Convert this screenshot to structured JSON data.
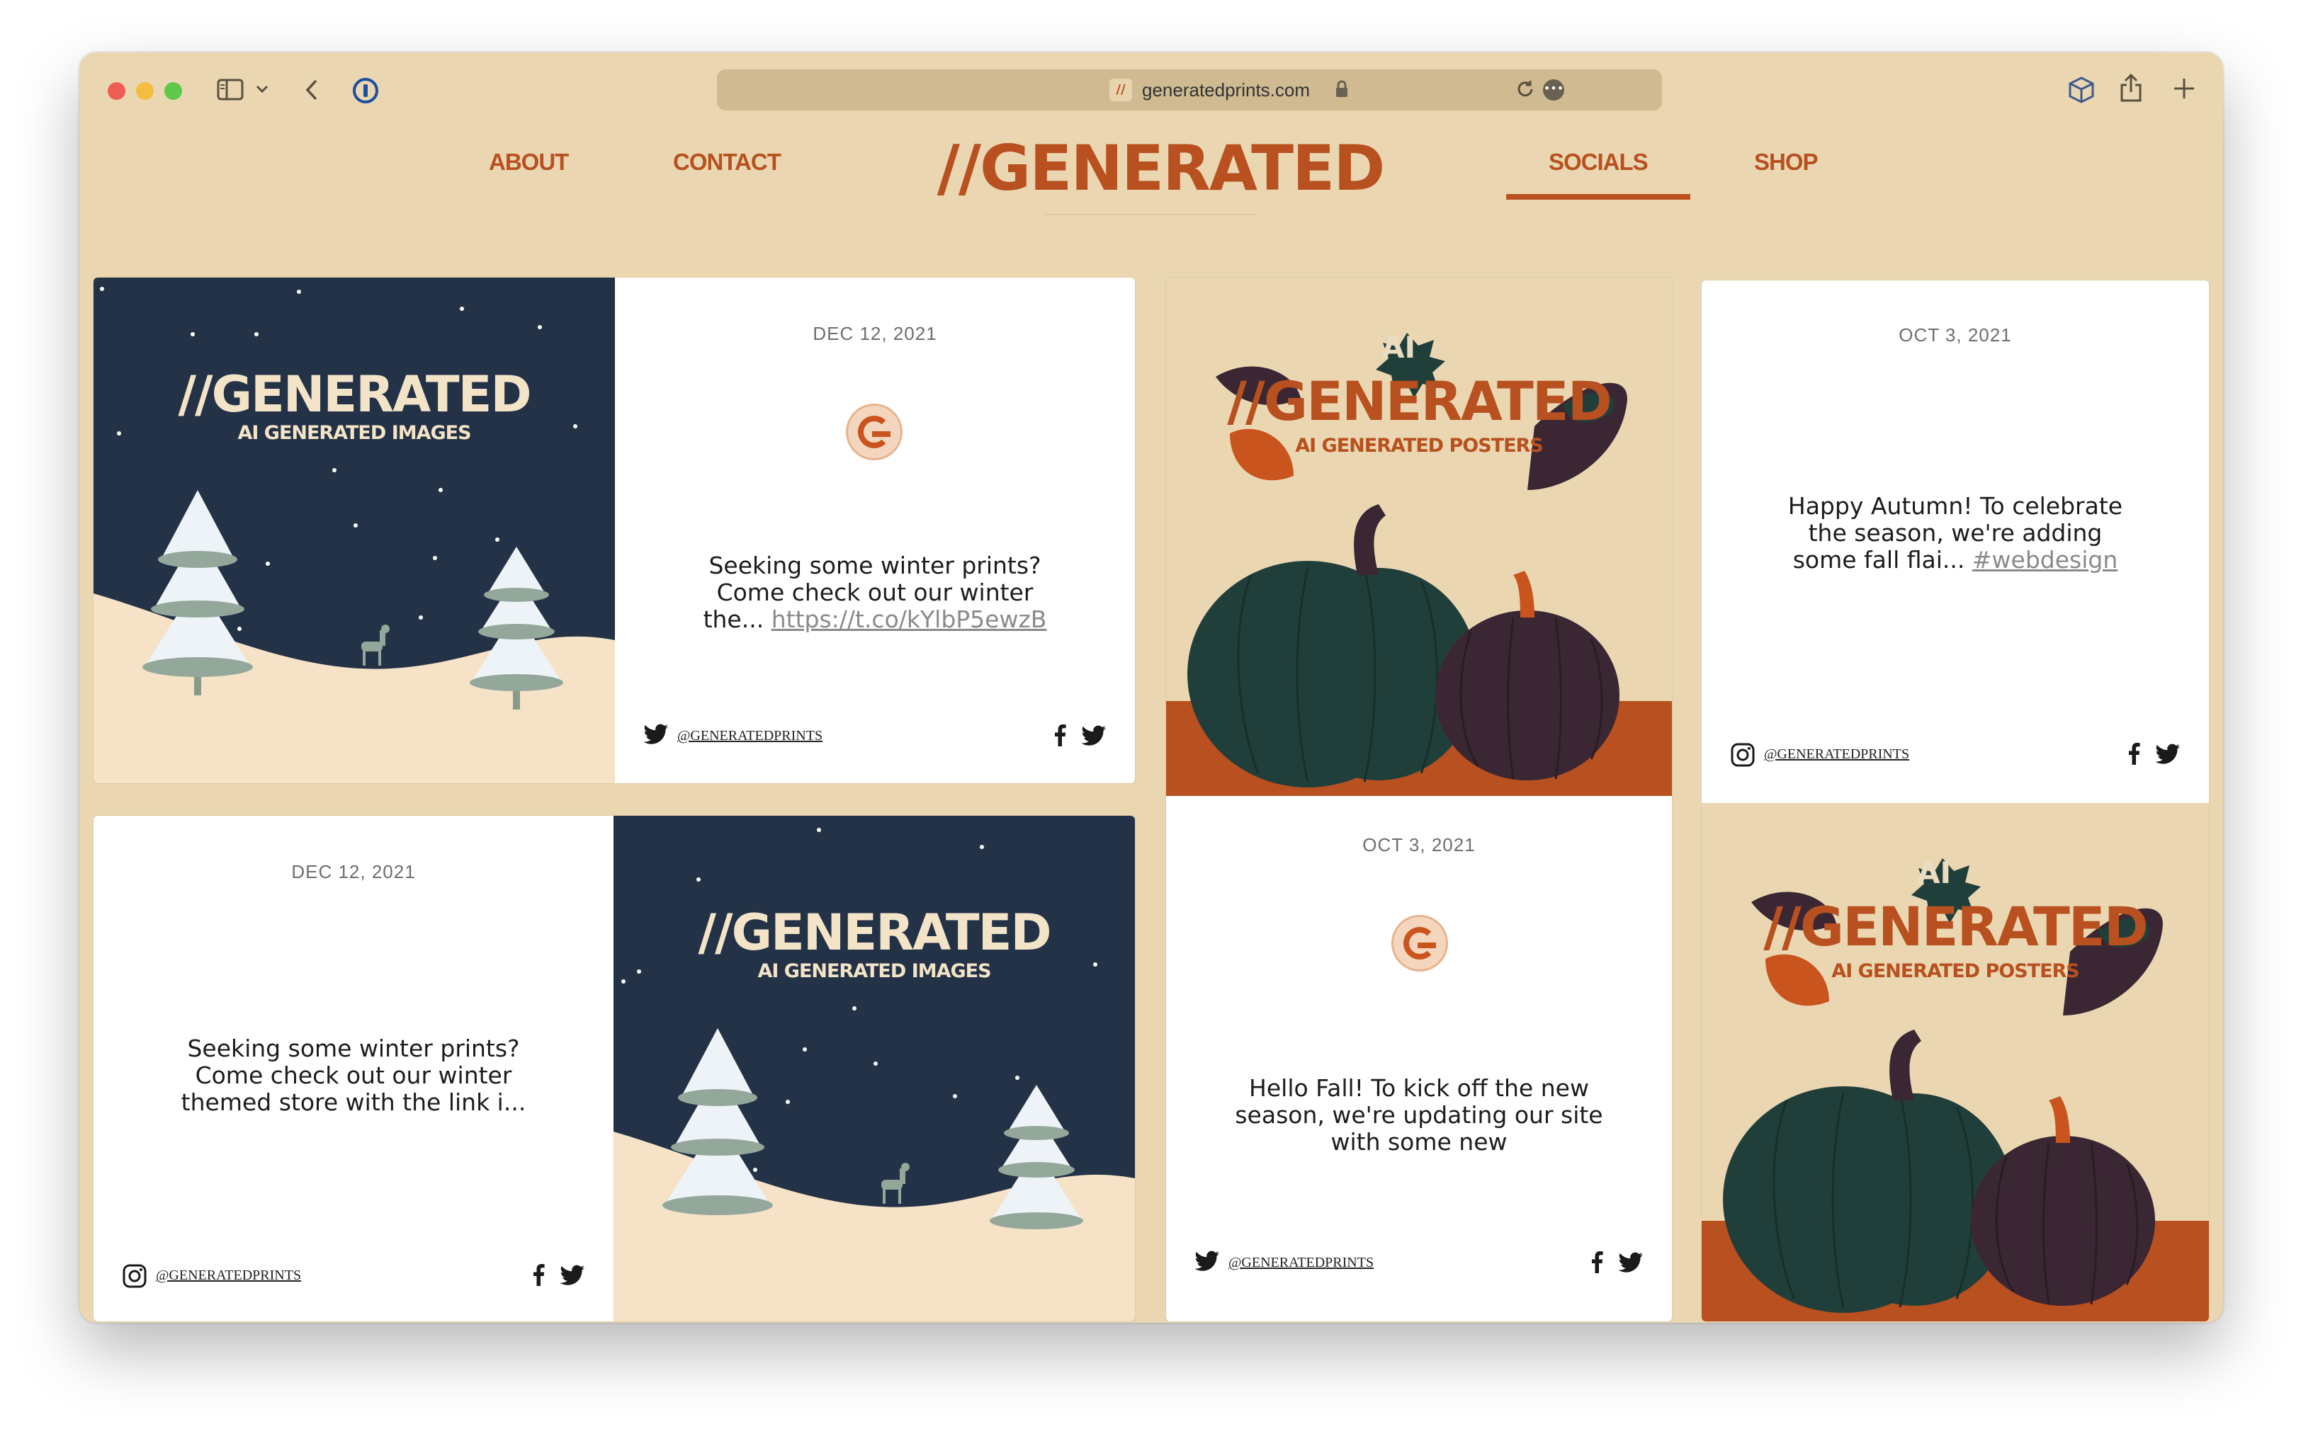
{
  "browser": {
    "url": "generatedprints.com",
    "favicon": "//"
  },
  "nav": {
    "about": "ABOUT",
    "contact": "CONTACT",
    "logo": "//GENERATED",
    "socials": "SOCIALS",
    "shop": "SHOP",
    "active": "SOCIALS"
  },
  "colors": {
    "page_bg": "#ead7b2",
    "accent": "#b8501f",
    "navy": "#243247",
    "pumpkin_green": "#213f3a",
    "pumpkin_purple": "#3a2733"
  },
  "posts": [
    {
      "source": "twitter-icon",
      "date": "DEC 12, 2021",
      "message": "Seeking some winter prints? Come check out our winter the...",
      "link": "https://t.co/kYlbP5ewzB",
      "handle": "@GENERATEDPRINTS"
    },
    {
      "source": "instagram-icon",
      "date": "DEC 12, 2021",
      "message": "Seeking some winter prints? Come check out our winter themed store with the link i...",
      "handle": "@GENERATEDPRINTS"
    },
    {
      "source": "twitter-icon",
      "date": "OCT 3, 2021",
      "message": "Hello Fall! To kick off the new season, we're updating our site with some new",
      "handle": "@GENERATEDPRINTS"
    },
    {
      "source": "instagram-icon",
      "date": "OCT 3, 2021",
      "message": "Happy Autumn! To celebrate the season, we're adding some fall flai...",
      "link": "#webdesign",
      "handle": "@GENERATEDPRINTS"
    }
  ],
  "posters": {
    "winter": {
      "title": "//GENERATED",
      "subtitle": "AI GENERATED IMAGES"
    },
    "autumn": {
      "made_with": "AI",
      "title": "//GENERATED",
      "subtitle": "AI GENERATED POSTERS"
    }
  }
}
